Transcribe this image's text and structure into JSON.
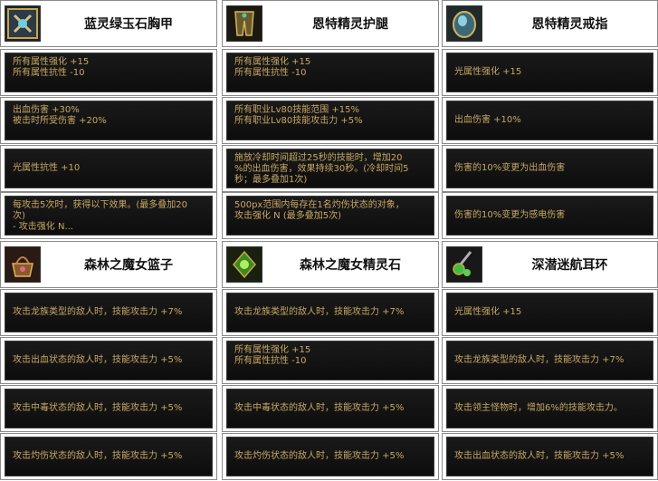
{
  "items": [
    {
      "title": "蓝灵绿玉石胸甲",
      "icon": "chestplate-icon",
      "stats": [
        [
          "所有属性强化 +15",
          "所有属性抗性 -10"
        ],
        [
          "出血伤害 +30%",
          "被击时所受伤害 +20%"
        ],
        [
          "光属性抗性 +10"
        ],
        [
          "每攻击5次时，获得以下效果。(最多叠加20",
          "次)",
          "- 攻击强化 N..."
        ]
      ]
    },
    {
      "title": "恩特精灵护腿",
      "icon": "leggings-icon",
      "stats": [
        [
          "所有属性强化 +15",
          "所有属性抗性 -10"
        ],
        [
          "所有职业Lv80技能范围 +15%",
          "所有职业Lv80技能攻击力 +5%"
        ],
        [
          "施放冷却时间超过25秒的技能时，增加20",
          "%的出血伤害，效果持续30秒。(冷却时间5",
          "秒；最多叠加1次)"
        ],
        [
          "500px范围内每存在1名灼伤状态的对象，",
          "攻击强化 N (最多叠加5次)"
        ]
      ]
    },
    {
      "title": "恩特精灵戒指",
      "icon": "ring-icon",
      "stats": [
        [
          "光属性强化 +15"
        ],
        [
          "出血伤害 +10%"
        ],
        [
          "伤害的10%变更为出血伤害"
        ],
        [
          "伤害的10%变更为感电伤害"
        ]
      ]
    },
    {
      "title": "森林之魔女篮子",
      "icon": "basket-icon",
      "stats": [
        [
          "攻击龙族类型的敌人时，技能攻击力 +7%"
        ],
        [
          "攻击出血状态的敌人时，技能攻击力 +5%"
        ],
        [
          "攻击中毒状态的敌人时，技能攻击力 +5%"
        ],
        [
          "攻击灼伤状态的敌人时，技能攻击力 +5%"
        ]
      ]
    },
    {
      "title": "森林之魔女精灵石",
      "icon": "spirit-stone-icon",
      "stats": [
        [
          "攻击龙族类型的敌人时，技能攻击力 +7%"
        ],
        [
          "所有属性强化 +15",
          "所有属性抗性 -10"
        ],
        [
          "攻击中毒状态的敌人时，技能攻击力 +5%"
        ],
        [
          "攻击灼伤状态的敌人时，技能攻击力 +5%"
        ]
      ]
    },
    {
      "title": "深潜迷航耳环",
      "icon": "earring-icon",
      "stats": [
        [
          "光属性强化 +15"
        ],
        [
          "攻击龙族类型的敌人时，技能攻击力 +7%"
        ],
        [
          "攻击领主怪物时，增加6%的技能攻击力。"
        ],
        [
          "攻击出血状态的敌人时，技能攻击力 +5%"
        ]
      ]
    }
  ],
  "colors": {
    "stat_text": "#c8a862",
    "stat_bg": "#111111",
    "border": "#8a8a8a"
  }
}
